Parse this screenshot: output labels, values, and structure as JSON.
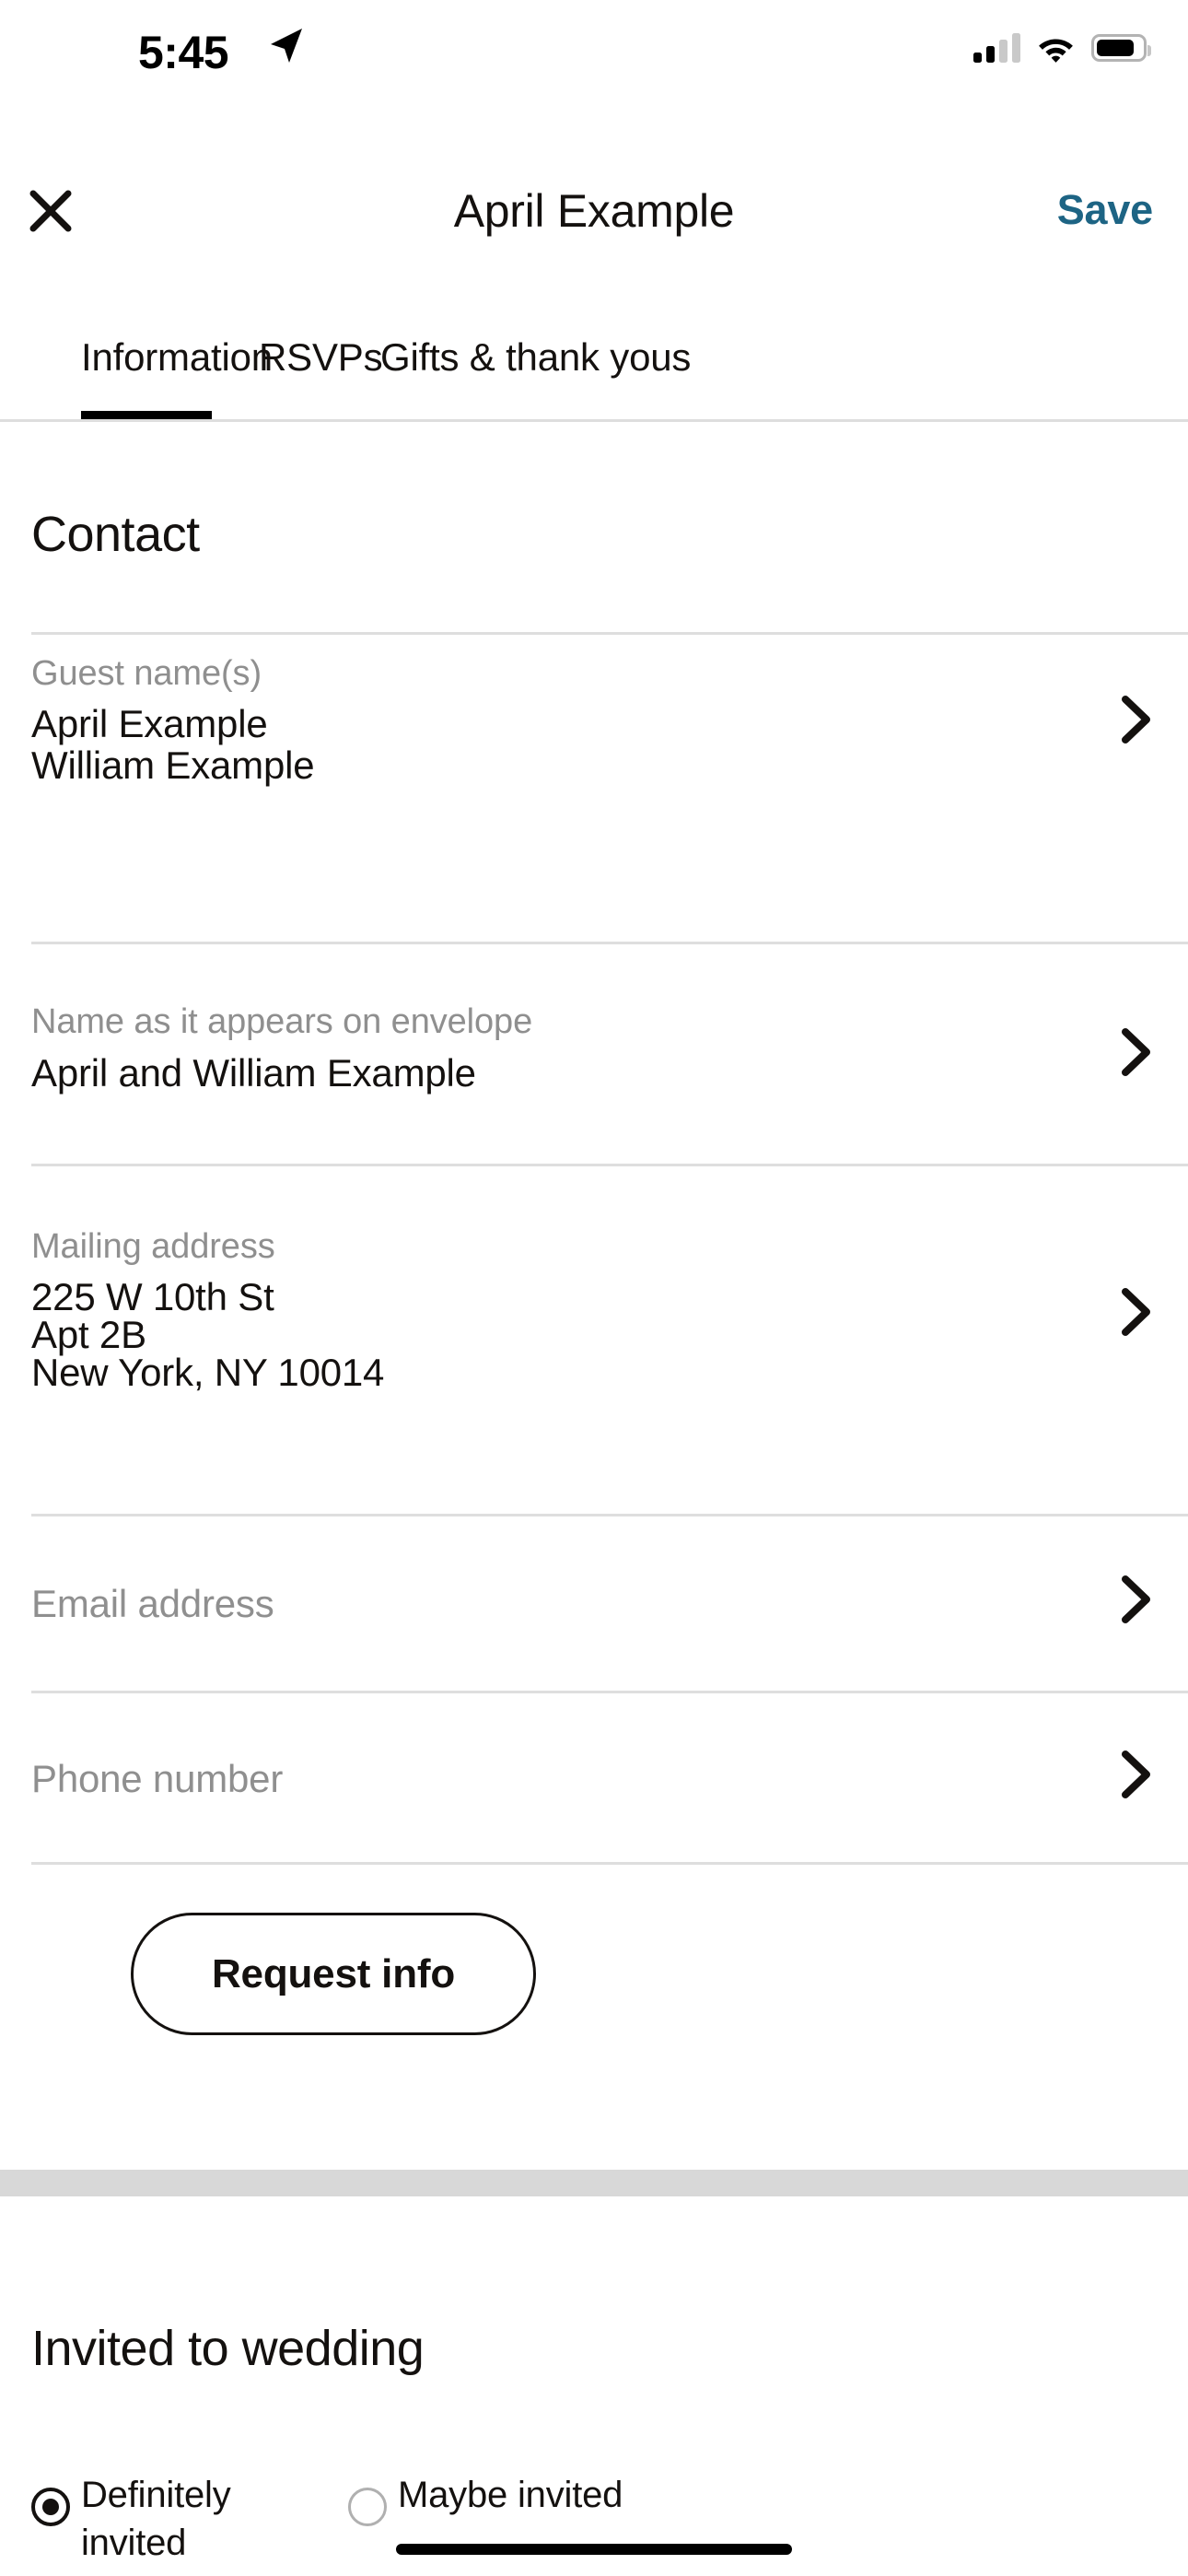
{
  "status_bar": {
    "time": "5:45",
    "location_icon": "location-arrow-icon",
    "cellular_icon": "cellular-signal-icon",
    "wifi_icon": "wifi-icon",
    "battery_icon": "battery-icon"
  },
  "nav": {
    "close_icon": "close-icon",
    "title": "April Example",
    "save_label": "Save",
    "save_color": "#1d6484"
  },
  "tabs": {
    "items": [
      {
        "label": "Information",
        "active": true
      },
      {
        "label": "RSVPs",
        "active": false
      },
      {
        "label": "Gifts & thank yous",
        "active": false
      }
    ]
  },
  "contact": {
    "title": "Contact",
    "fields": [
      {
        "label": "Guest name(s)",
        "values": [
          "April Example",
          "William Example"
        ],
        "placeholder": "",
        "chevron": "chevron-right-icon"
      },
      {
        "label": "Name as it appears on envelope",
        "values": [
          "April and William Example"
        ],
        "placeholder": "",
        "chevron": "chevron-right-icon"
      },
      {
        "label": "Mailing address",
        "values": [
          "225 W 10th St",
          "Apt 2B",
          "New York, NY 10014"
        ],
        "placeholder": "",
        "chevron": "chevron-right-icon"
      },
      {
        "label": "",
        "values": [],
        "placeholder": "Email address",
        "chevron": "chevron-right-icon"
      },
      {
        "label": "",
        "values": [],
        "placeholder": "Phone number",
        "chevron": "chevron-right-icon"
      }
    ],
    "request_info_label": "Request info"
  },
  "invited": {
    "title": "Invited to wedding",
    "options": [
      {
        "label": "Definitely invited",
        "selected": true
      },
      {
        "label": "Maybe invited",
        "selected": false
      }
    ]
  },
  "field_text": {
    "guest_names_label": "Guest name(s)",
    "guest_name_1": "April Example",
    "guest_name_2": "William Example",
    "envelope_label": "Name as it appears on envelope",
    "envelope_value": "April and William Example",
    "mailing_label": "Mailing address",
    "mailing_line_1": "225 W 10th St",
    "mailing_line_2": "Apt 2B",
    "mailing_line_3": "New York, NY 10014",
    "email_placeholder": "Email address",
    "phone_placeholder": "Phone number"
  }
}
